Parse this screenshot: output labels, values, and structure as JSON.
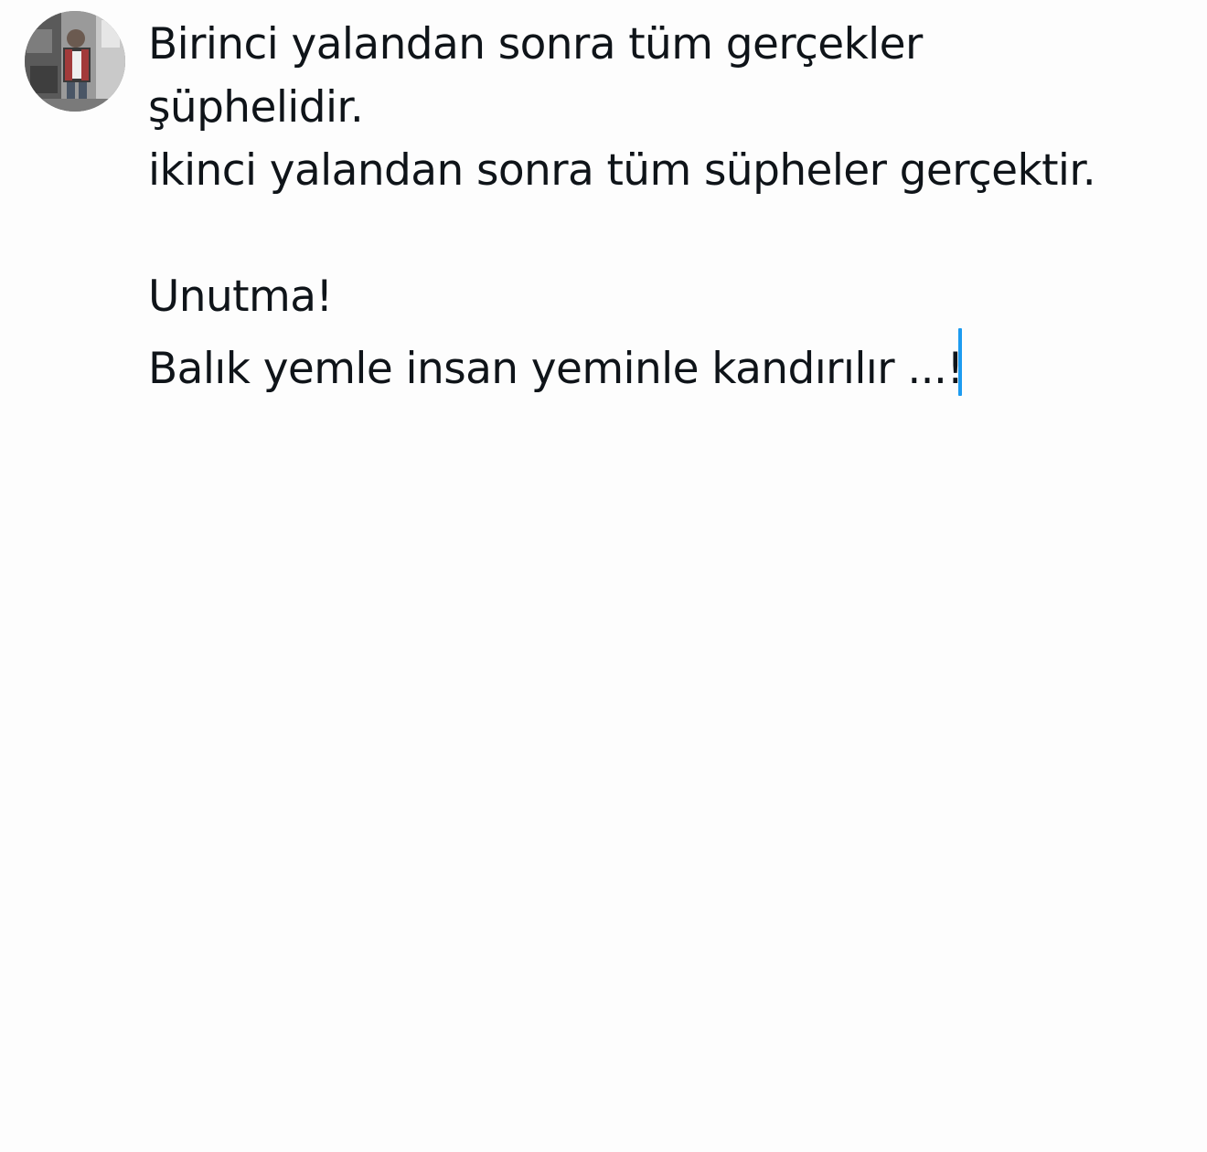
{
  "composer": {
    "avatar_icon": "user-avatar-photo",
    "text_lines": [
      "Birinci yalandan sonra tüm gerçekler",
      "şüphelidir.",
      "ikinci yalandan sonra tüm süpheler gerçektir.",
      "",
      "Unutma!",
      "Balık yemle insan yeminle kandırılır ...!"
    ],
    "caret_color": "#1d9bf0"
  }
}
